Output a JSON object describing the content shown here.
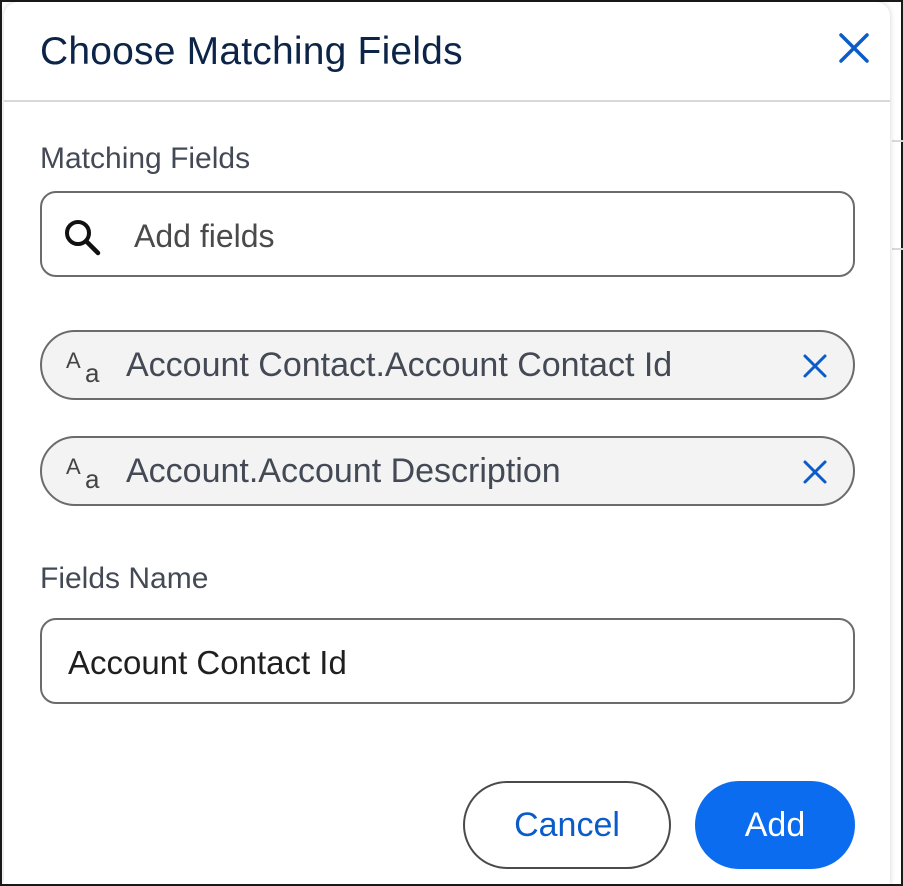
{
  "dialog": {
    "title": "Choose Matching Fields"
  },
  "matching_fields": {
    "label": "Matching Fields",
    "search_placeholder": "Add fields",
    "selected": [
      {
        "label": "Account Contact.Account Contact Id",
        "type_icon": "text-type-icon"
      },
      {
        "label": "Account.Account Description",
        "type_icon": "text-type-icon"
      }
    ],
    "type_icon_glyphs": {
      "big": "A",
      "small": "a"
    }
  },
  "fields_name": {
    "label": "Fields Name",
    "value": "Account Contact Id"
  },
  "actions": {
    "cancel_label": "Cancel",
    "add_label": "Add"
  },
  "colors": {
    "brand_blue": "#0b6cf0",
    "link_blue": "#0b5cc9",
    "title_navy": "#0b2447"
  }
}
